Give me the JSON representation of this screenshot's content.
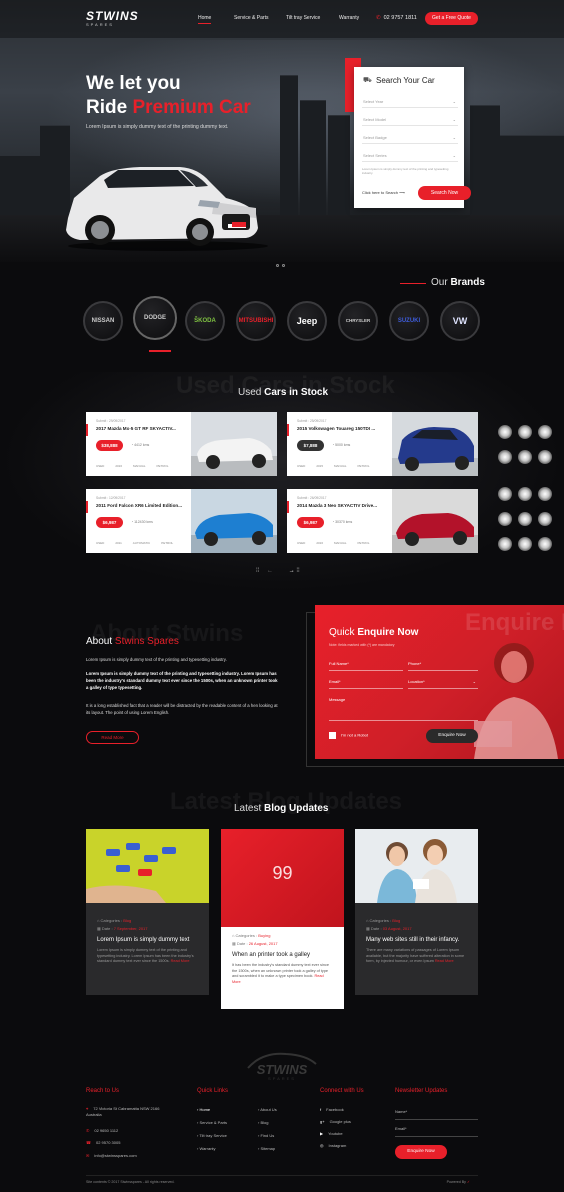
{
  "header": {
    "logo_text": "STWINS",
    "logo_sub": "SPARES",
    "nav": [
      "Home",
      "Service & Parts",
      "Tilt tray Service",
      "Warranty"
    ],
    "phone": "02 9757 1811",
    "cta": "Get a Free Quote"
  },
  "hero": {
    "line1": "We let you",
    "line2_white": "Ride",
    "line2_red": "Premium Car",
    "subtitle": "Lorem Ipsum is simply dummy text of the printing dummy text.",
    "search": {
      "title": "Search Your Car",
      "fields": [
        "Select Year",
        "Select Model",
        "Select Badge",
        "Select Series"
      ],
      "note": "Lorem Ipsum is simply dummy text of the printing and typesetting industry.",
      "link": "Click here to Search",
      "button": "Search Now"
    }
  },
  "brands": {
    "title_normal": "Our",
    "title_bold": "Brands",
    "items": [
      "NISSAN",
      "DODGE",
      "ŠKODA",
      "MITSUBISHI",
      "Jeep",
      "CHRYSLER",
      "SUZUKI",
      "VW"
    ]
  },
  "used_cars": {
    "ghost": "Used Cars in Stock",
    "title_normal": "Used",
    "title_bold": "Cars in Stock",
    "cards": [
      {
        "submit": "Submit : 29/09/2017",
        "name": "2017 Mazda Mx-5 GT RF SKYACTIV...",
        "price": "$38,888",
        "km": "4412 kms",
        "specs": [
          "USED",
          "2016",
          "MANUAL",
          "PETROL"
        ],
        "price_color": "#e8202a"
      },
      {
        "submit": "Submit : 25/09/2017",
        "name": "2015 Volkswagen Touareg 150TDI ...",
        "price": "$7,888",
        "km": "5000 kms",
        "specs": [
          "USED",
          "2015",
          "MANUAL",
          "PETROL"
        ],
        "price_color": "#333333"
      },
      {
        "submit": "Submit : 12/09/2017",
        "name": "2011 Ford Falcon XR6 Limited Edition...",
        "price": "$6,987",
        "km": "112430 kms",
        "specs": [
          "USED",
          "2011",
          "AUTOMATIC",
          "PETROL"
        ],
        "price_color": "#e8202a"
      },
      {
        "submit": "Submit : 26/09/2017",
        "name": "2014 Mazda 3 Neo SKYACTIV Drive...",
        "price": "$6,987",
        "km": "30370 kms",
        "specs": [
          "USED",
          "2016",
          "MANUAL",
          "PETROL"
        ],
        "price_color": "#e8202a"
      }
    ],
    "pager_left": "←",
    "pager_right": "→"
  },
  "about": {
    "ghost": "About Stwins",
    "title_white": "About",
    "title_red": "Stwins Spares",
    "p1": "Lorem Ipsum is simply dummy text of the printing and typesetting industry.",
    "p2": "Lorem Ipsum is simply dummy text of the printing and typesetting industry. Lorem Ipsum has been the industry's standard dummy text ever since the 1500s, when an unknown printer took a galley of type typesetting.",
    "p3": "It is a long established fact that a reader will be distracted by the readable content of a hen looking at its layout. The point of using Lorem English.",
    "button": "Read More"
  },
  "enquire": {
    "ghost": "Enquire Now",
    "title_normal": "Quick",
    "title_bold": "Enquire Now",
    "required": "Note: fields marked with (*) are mandatory",
    "fields": [
      "Full Name*",
      "Phone*",
      "Email*",
      "Location*",
      "Message"
    ],
    "robot": "I'm not a Robot",
    "button": "Enquire Now"
  },
  "blog": {
    "ghost": "Latest Blog Updates",
    "title_normal": "Latest",
    "title_bold": "Blog Updates",
    "posts": [
      {
        "category_label": "Categories :",
        "category": "Blog",
        "date_label": "Date :",
        "date": "7 September, 2017",
        "title": "Lorem Ipsum is simply dummy text",
        "text": "Lorem Ipsum is simply dummy text of the printing and typesetting industry. Lorem Ipsum has been the industry's standard dummy text ever since the 1500s.",
        "more": "Read More"
      },
      {
        "category_label": "Categories :",
        "category": "Buying",
        "date_label": "Date :",
        "date": "26 August, 2017",
        "title": "When an printer took a galley",
        "text": "It has been the industry's standard dummy text ever since the 1500s, when an unknown printer took a galley of type and scrambled it to make a type specimen book.",
        "more": "Read More",
        "number": "99"
      },
      {
        "category_label": "Categories :",
        "category": "Blog",
        "date_label": "Date :",
        "date": "03 August, 2017",
        "title": "Many web sites still in their infancy.",
        "text": "There are many variations of passages of Lorem Ipsum available, but the majority have suffered alteration in some form, by injected humour, or even Ipsum",
        "more": "Read More"
      }
    ]
  },
  "footer": {
    "reach_title": "Reach to Us",
    "address": "72 Victoria St Cabramatta NSW 2166 Australia",
    "phone1": "02 9650 1112",
    "phone2": "02 9570 3005",
    "email": "info@stwinsspares.com",
    "links_title": "Quick Links",
    "links_col1": [
      "Home",
      "Service & Parts",
      "Tilt tray Service",
      "Warranty"
    ],
    "links_col2": [
      "About Us",
      "Blog",
      "Find Us",
      "Sitemap"
    ],
    "connect_title": "Connect with Us",
    "social": [
      "Facebook",
      "Google plus",
      "Youtube",
      "Instagram"
    ],
    "news_title": "Newsletter Updates",
    "news_fields": [
      "Name*",
      "Email*"
    ],
    "news_button": "Enquire Now",
    "copyright": "Site contents © 2017 Stwinsspares - All rights reserved.",
    "powered": "Powered By"
  }
}
